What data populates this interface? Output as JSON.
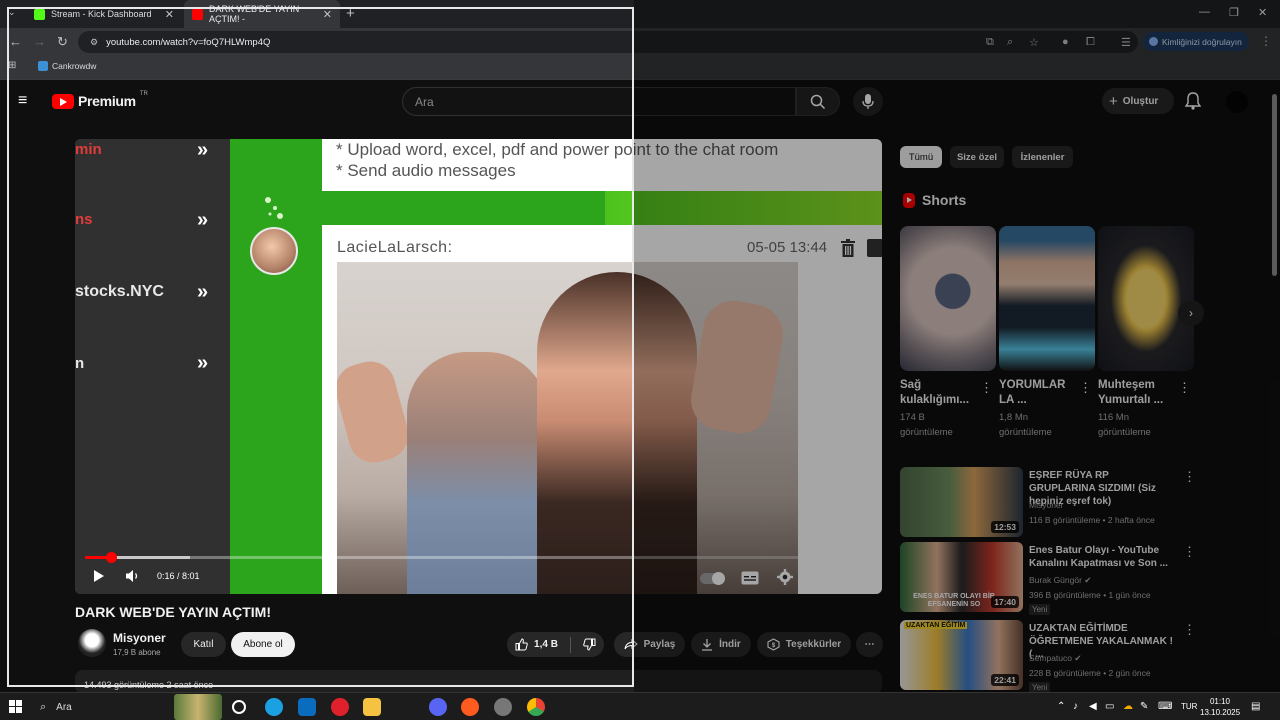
{
  "browser": {
    "tabs": [
      {
        "title": "Stream - Kick Dashboard",
        "favicon_color": "#53fc18"
      },
      {
        "title": "DARK WEB'DE YAYIN AÇTIM! -",
        "favicon_color": "#ff0000"
      }
    ],
    "url": "youtube.com/watch?v=foQ7HLWmp4Q",
    "profile_label": "Kimliğinizi doğrulayın",
    "bookmark": "Cankrowdw"
  },
  "youtube": {
    "logo_text": "Premium",
    "logo_region": "TR",
    "search_placeholder": "Ara",
    "create_label": "Oluştur"
  },
  "video": {
    "left_texts": [
      "min",
      "ns",
      "stocks.NYC",
      "n"
    ],
    "chat_lines": [
      "* Upload word, excel, pdf and power point to the chat room",
      "* Send audio messages"
    ],
    "chat_user": "LacieLaLarsch:",
    "chat_time": "05-05 13:44",
    "time_display": "0:16 / 8:01",
    "progress": 0.033,
    "accent": "#ff0000"
  },
  "meta": {
    "title": "DARK WEB'DE YAYIN AÇTIM!",
    "channel": "Misyoner",
    "subs": "17,9 B abone",
    "join": "Katıl",
    "subscribe": "Abone ol",
    "likes": "1,4 B",
    "share": "Paylaş",
    "download": "İndir",
    "thanks": "Teşekkürler",
    "desc": "14.493 görüntüleme 2 saat önce"
  },
  "sidebar": {
    "chips": [
      "Tümü",
      "Size özel",
      "İzlenenler"
    ],
    "shorts_title": "Shorts",
    "shorts": [
      {
        "title": "Sağ kulaklığımı...",
        "views": "174 B görüntüleme"
      },
      {
        "title": "YORUMLAR LA ...",
        "views": "1,8 Mn görüntüleme"
      },
      {
        "title": "Muhteşem Yumurtalı ...",
        "views": "116 Mn görüntüleme"
      }
    ],
    "recs": [
      {
        "title": "EŞREF RÜYA RP GRUPLARINA SIZDIM! (Siz hepiniz eşref tok)",
        "channel": "Misyoner",
        "meta": "116 B görüntüleme • 2 hafta önce",
        "duration": "12:53",
        "new": ""
      },
      {
        "title": "Enes Batur Olayı - YouTube Kanalını Kapatması ve Son ...",
        "channel": "Burak Güngör ✔",
        "meta": "396 B görüntüleme • 1 gün önce",
        "duration": "17:40",
        "new": "Yeni",
        "thumb_text": "ENES BATUR OLAYI BİR EFSANENİN SO"
      },
      {
        "title": "UZAKTAN EĞİTİMDE ÖĞRETMENE YAKALANMAK ! ( ...",
        "channel": "Sempatuco ✔",
        "meta": "228 B görüntüleme • 2 gün önce",
        "duration": "22:41",
        "new": "Yeni",
        "thumb_text": "UZAKTAN EĞİTİM"
      }
    ]
  },
  "taskbar": {
    "search": "Ara",
    "lang": "TUR",
    "time": "01:10",
    "date": "13.10.2025"
  }
}
